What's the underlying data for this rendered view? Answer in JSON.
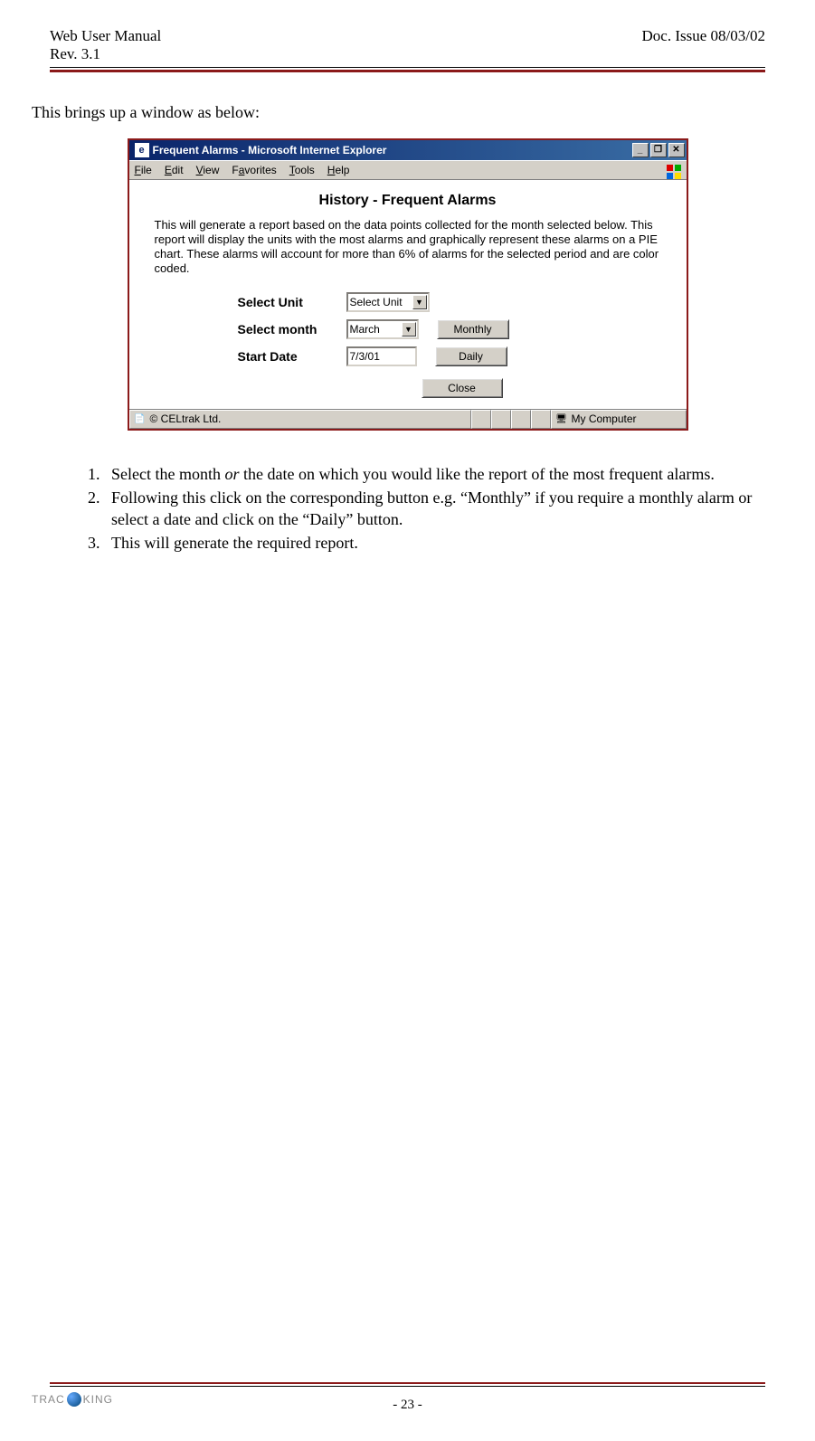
{
  "header": {
    "title": "Web User Manual",
    "rev": "Rev. 3.1",
    "doc_issue": "Doc. Issue 08/03/02"
  },
  "intro": "This brings up a window as below:",
  "ie_window": {
    "title": "Frequent Alarms - Microsoft Internet Explorer",
    "menus": {
      "file": "File",
      "edit": "Edit",
      "view": "View",
      "favorites": "Favorites",
      "tools": "Tools",
      "help": "Help"
    },
    "heading": "History - Frequent Alarms",
    "description": "This will generate a report based on the data points collected for the month selected below. This report will display the units with the most alarms and graphically represent these alarms on a PIE chart. These alarms will account for more than 6% of alarms for the selected period and are color coded.",
    "labels": {
      "select_unit": "Select Unit",
      "select_month": "Select month",
      "start_date": "Start Date"
    },
    "values": {
      "unit": "Select Unit",
      "month": "March",
      "date": "7/3/01"
    },
    "buttons": {
      "monthly": "Monthly",
      "daily": "Daily",
      "close": "Close"
    },
    "status": {
      "left": "© CELtrak Ltd.",
      "zone": "My Computer"
    },
    "title_btns": {
      "min": "_",
      "max": "❐",
      "close": "✕"
    }
  },
  "instructions": {
    "item1_a": "Select the month ",
    "item1_or": "or",
    "item1_b": " the date on which you would like the report of the most frequent alarms.",
    "item2": "Following this click on the corresponding button e.g. “Monthly” if you require a monthly alarm or select a date and click on the “Daily” button.",
    "item3": "This will generate the required report."
  },
  "footer": {
    "page": "- 23 -",
    "logo_a": "TRAC",
    "logo_b": "KING"
  }
}
